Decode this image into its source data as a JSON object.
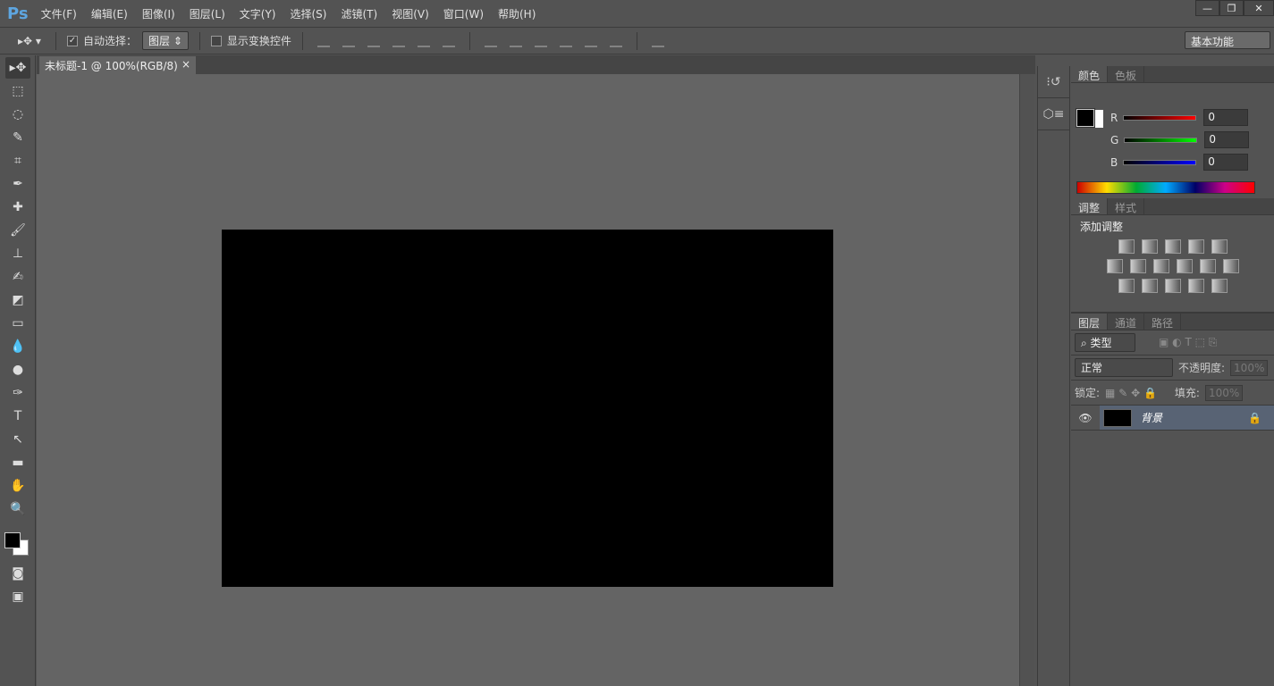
{
  "app": {
    "logo": "Ps"
  },
  "menu": [
    "文件(F)",
    "编辑(E)",
    "图像(I)",
    "图层(L)",
    "文字(Y)",
    "选择(S)",
    "滤镜(T)",
    "视图(V)",
    "窗口(W)",
    "帮助(H)"
  ],
  "window_controls": {
    "minimize": "—",
    "restore": "❐",
    "close": "✕"
  },
  "options": {
    "auto_select_label": "自动选择：",
    "auto_select_checked": true,
    "auto_select_value": "图层",
    "show_transform_label": "显示变换控件",
    "workspace": "基本功能"
  },
  "document": {
    "tab_title": "未标题-1 @ 100%(RGB/8) *",
    "close": "×"
  },
  "color_panel": {
    "tabs": [
      "颜色",
      "色板"
    ],
    "channels": [
      {
        "label": "R",
        "value": "0",
        "color": "#ff0000"
      },
      {
        "label": "G",
        "value": "0",
        "color": "#00ff00"
      },
      {
        "label": "B",
        "value": "0",
        "color": "#0000ff"
      }
    ]
  },
  "adjust_panel": {
    "tabs": [
      "调整",
      "样式"
    ],
    "title": "添加调整"
  },
  "layers_panel": {
    "tabs": [
      "图层",
      "通道",
      "路径"
    ],
    "filter": "类型",
    "blend_mode": "正常",
    "opacity_label": "不透明度:",
    "opacity": "100%",
    "lock_label": "锁定:",
    "fill_label": "填充:",
    "fill": "100%",
    "layers": [
      {
        "name": "背景",
        "visible": true,
        "locked": true
      }
    ]
  }
}
